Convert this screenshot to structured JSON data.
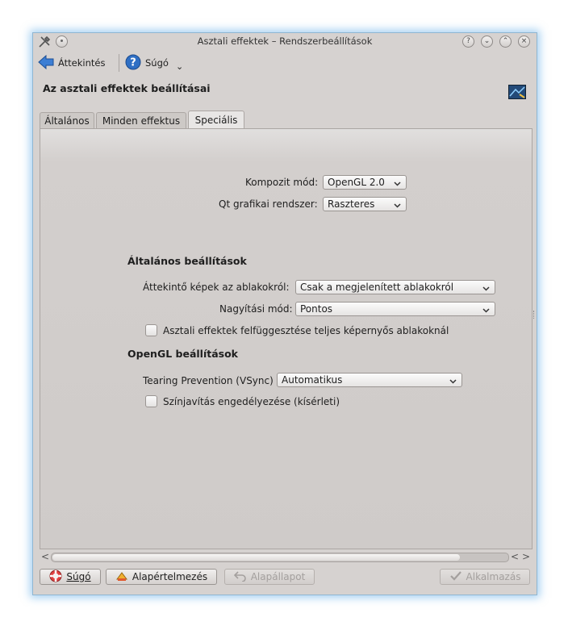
{
  "window": {
    "title": "Asztali effektek – Rendszerbeállítások",
    "title_buttons": [
      "?",
      "⌄",
      "⌃",
      "×"
    ]
  },
  "toolbar": {
    "overview_label": "Áttekintés",
    "help_label": "Súgó",
    "menu_arrow": "⌄"
  },
  "page": {
    "title": "Az asztali effektek beállításai"
  },
  "tabs": [
    {
      "label": "Általános"
    },
    {
      "label": "Minden effektus"
    },
    {
      "label": "Speciális",
      "active": true
    }
  ],
  "advanced": {
    "compositing_label": "Kompozit mód:",
    "compositing_value": "OpenGL 2.0",
    "qt_label": "Qt grafikai rendszer:",
    "qt_value": "Raszteres",
    "general_section": "Általános beállítások",
    "thumbnails_label": "Áttekintő képek az ablakokról:",
    "thumbnails_value": "Csak a megjelenített ablakokról",
    "scale_label": "Nagyítási mód:",
    "scale_value": "Pontos",
    "suspend_label": "Asztali effektek felfüggesztése teljes képernyős ablakoknál",
    "suspend_checked": false,
    "opengl_section": "OpenGL beállítások",
    "tearing_label": "Tearing Prevention (VSync)",
    "tearing_value": "Automatikus",
    "color_label": "Színjavítás engedélyezése (kísérleti)",
    "color_checked": false
  },
  "scrollbar": {
    "left_arrow": "<",
    "right_arrow": ">",
    "position": 0.0
  },
  "buttons": {
    "help": "Súgó",
    "defaults": "Alapértelmezés",
    "reset": "Alapállapot",
    "apply": "Alkalmazás"
  },
  "colors": {
    "window_bg": "#d6d2d0",
    "window_glow": "#5caae6",
    "help_icon": "#2f6fc4"
  }
}
